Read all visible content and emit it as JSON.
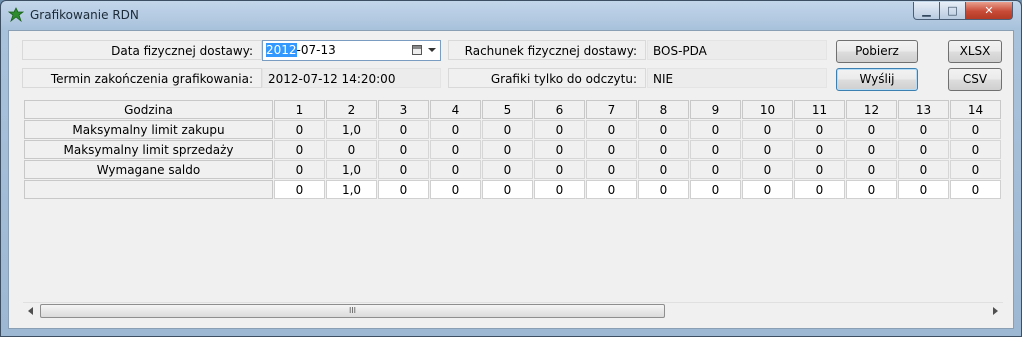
{
  "window": {
    "title": "Grafikowanie RDN",
    "app_icon": "green-leaf-icon",
    "minimize_glyph": "▁",
    "maximize_glyph": "□",
    "close_glyph": "✕"
  },
  "form": {
    "date_label": "Data fizycznej dostawy:",
    "date_value_selected": "2012",
    "date_value_rest": "-07-13",
    "deadline_label": "Termin zakończenia grafikowania:",
    "deadline_value": "2012-07-12 14:20:00",
    "account_label": "Rachunek fizycznej dostawy:",
    "account_value": "BOS-PDA",
    "readonly_label": "Grafiki tylko do odczytu:",
    "readonly_value": "NIE"
  },
  "buttons": {
    "fetch": "Pobierz",
    "send": "Wyślij",
    "xlsx": "XLSX",
    "csv": "CSV"
  },
  "grid": {
    "header_label": "Godzina",
    "hours": [
      "1",
      "2",
      "3",
      "4",
      "5",
      "6",
      "7",
      "8",
      "9",
      "10",
      "11",
      "12",
      "13",
      "14"
    ],
    "rows": [
      {
        "label": "Maksymalny limit zakupu",
        "values": [
          "0",
          "1,0",
          "0",
          "0",
          "0",
          "0",
          "0",
          "0",
          "0",
          "0",
          "0",
          "0",
          "0",
          "0"
        ]
      },
      {
        "label": "Maksymalny limit sprzedaży",
        "values": [
          "0",
          "0",
          "0",
          "0",
          "0",
          "0",
          "0",
          "0",
          "0",
          "0",
          "0",
          "0",
          "0",
          "0"
        ]
      },
      {
        "label": "Wymagane saldo",
        "values": [
          "0",
          "1,0",
          "0",
          "0",
          "0",
          "0",
          "0",
          "0",
          "0",
          "0",
          "0",
          "0",
          "0",
          "0"
        ]
      }
    ],
    "input_row": {
      "label": "",
      "values": [
        "0",
        "1,0",
        "0",
        "0",
        "0",
        "0",
        "0",
        "0",
        "0",
        "0",
        "0",
        "0",
        "0",
        "0"
      ]
    }
  },
  "scrollbar": {
    "grip": "III"
  }
}
